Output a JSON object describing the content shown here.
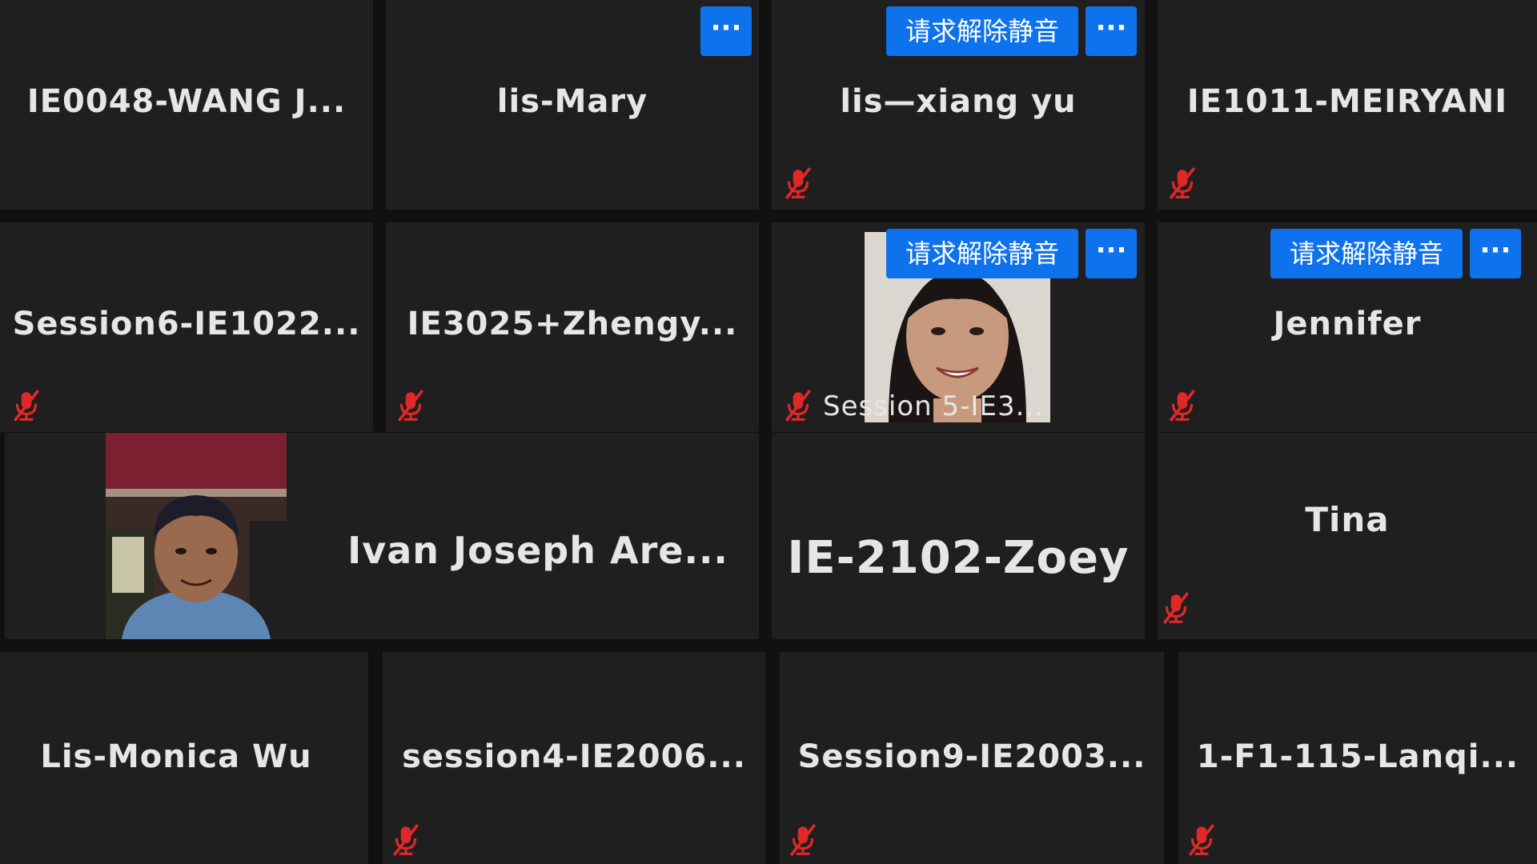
{
  "labels": {
    "request_unmute": "请求解除静音",
    "more": "···"
  },
  "colors": {
    "tile_bg": "#1f1f1f",
    "accent_button": "#0e72ed",
    "muted_icon": "#e02828",
    "name_text": "#e6e6e6"
  },
  "icons": {
    "muted": "mic-off-icon",
    "more": "ellipsis-icon"
  },
  "participants": [
    {
      "name": "IE0048-WANG J...",
      "muted": false
    },
    {
      "name": "lis-Mary",
      "muted": false,
      "more_button": true
    },
    {
      "name": "lis—xiang yu",
      "muted": true,
      "request_unmute": true,
      "more_button": true
    },
    {
      "name": "IE1011-MEIRYANI",
      "muted": true
    },
    {
      "name": "Session6-IE1022...",
      "muted": true
    },
    {
      "name": "IE3025+Zhengy...",
      "muted": true
    },
    {
      "name": "Session 5-IE3...",
      "muted": true,
      "video": true,
      "request_unmute": true,
      "more_button": true
    },
    {
      "name": "Jennifer",
      "muted": true,
      "request_unmute": true,
      "more_button": true
    },
    {
      "name": "Ivan Joseph Are...",
      "muted": false,
      "video": true
    },
    {
      "name": "IE-2102-Zoey",
      "muted": false
    },
    {
      "name": "Tina",
      "muted": true
    },
    {
      "name": "Lis-Monica Wu",
      "muted": false
    },
    {
      "name": "session4-IE2006...",
      "muted": true
    },
    {
      "name": "Session9-IE2003...",
      "muted": true
    },
    {
      "name": "1-F1-115-Lanqi...",
      "muted": true
    }
  ]
}
